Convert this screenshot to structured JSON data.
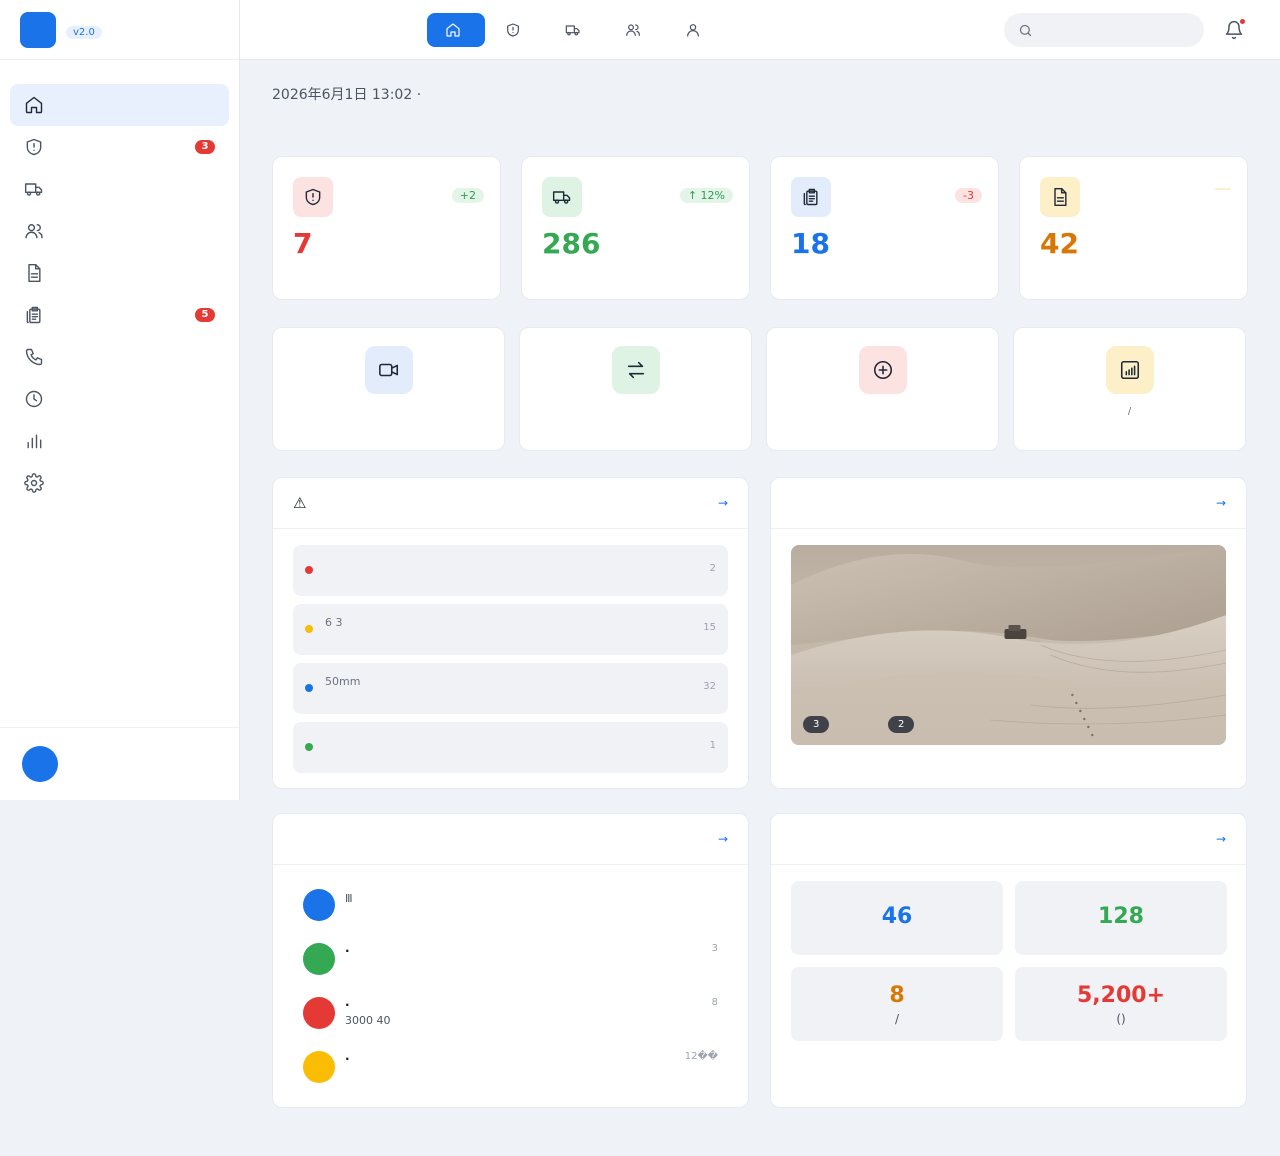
{
  "brand": {
    "logo_glyph": "",
    "name": "",
    "version": "v2.0"
  },
  "sidebar": {
    "section_title": "",
    "items": [
      {
        "label": "",
        "icon": "home-icon",
        "active": true,
        "badge": ""
      },
      {
        "label": "",
        "icon": "shield-alert-icon",
        "active": false,
        "badge": "3"
      },
      {
        "label": "",
        "icon": "truck-icon",
        "active": false,
        "badge": ""
      },
      {
        "label": "",
        "icon": "users-icon",
        "active": false,
        "badge": ""
      },
      {
        "label": "",
        "icon": "document-icon",
        "active": false,
        "badge": ""
      },
      {
        "label": "",
        "icon": "clipboard-icon",
        "active": false,
        "badge": "5"
      },
      {
        "label": "",
        "icon": "phone-icon",
        "active": false,
        "badge": ""
      },
      {
        "label": "",
        "icon": "clock-icon",
        "active": false,
        "badge": ""
      },
      {
        "label": "",
        "icon": "bar-chart-icon",
        "active": false,
        "badge": ""
      },
      {
        "label": "",
        "icon": "gear-icon",
        "active": false,
        "badge": ""
      }
    ],
    "user": {
      "avatar": "",
      "name": "",
      "role": ""
    }
  },
  "topbar": {
    "title": "",
    "tabs": [
      {
        "label": "",
        "icon": "home-icon",
        "active": true
      },
      {
        "label": "",
        "icon": "shield-alert-icon",
        "active": false
      },
      {
        "label": "",
        "icon": "truck-icon",
        "active": false
      },
      {
        "label": "",
        "icon": "users-icon",
        "active": false
      },
      {
        "label": "",
        "icon": "user-icon",
        "active": false
      }
    ],
    "search_placeholder": "",
    "bell_icon": "bell-icon"
  },
  "page": {
    "title": "",
    "subtitle": "2026年6月1日 13:02 · "
  },
  "stats": [
    {
      "value": "7",
      "label": "",
      "chip": "+2",
      "icon": "shield-alert-icon",
      "color": "#e53935",
      "bg": "#fde2e2",
      "chip_color": "#2e9d4f",
      "chip_bg": "#e3f5e8"
    },
    {
      "value": "286",
      "label": "",
      "chip": "↑ 12%",
      "icon": "truck-icon",
      "color": "#34a853",
      "bg": "#dff3e4",
      "chip_color": "#2e9d4f",
      "chip_bg": "#e3f5e8"
    },
    {
      "value": "18",
      "label": "",
      "chip": "-3",
      "icon": "clipboard-icon",
      "color": "#1a73e8",
      "bg": "#e3ecfb",
      "chip_color": "#e53935",
      "chip_bg": "#fde2e2"
    },
    {
      "value": "42",
      "label": "",
      "chip": "",
      "icon": "document-icon",
      "color": "#d97706",
      "bg": "#fdf0c8",
      "chip_color": "#d97706",
      "chip_bg": "#fdf0c8"
    }
  ],
  "actions": [
    {
      "title": "",
      "sub": "",
      "icon": "video-icon",
      "bg": "#e3ecfb"
    },
    {
      "title": "",
      "sub": "",
      "icon": "swap-icon",
      "bg": "#dff3e4"
    },
    {
      "title": "",
      "sub": "",
      "icon": "plus-circle-icon",
      "bg": "#fde2e2"
    },
    {
      "title": "",
      "sub": "/",
      "icon": "report-icon",
      "bg": "#fdf0c8"
    }
  ],
  "alerts_panel": {
    "title": "⚠ ",
    "link": " →",
    "items": [
      {
        "title": "",
        "desc": "",
        "time": "2",
        "color": "#e53935"
      },
      {
        "title": "",
        "desc": "6  3",
        "time": "15",
        "color": "#fbbc04"
      },
      {
        "title": "",
        "desc": "50mm",
        "time": "32",
        "color": "#1a73e8"
      },
      {
        "title": "",
        "desc": "",
        "time": "1",
        "color": "#34a853"
      }
    ]
  },
  "photo_panel": {
    "title": " ",
    "link": " →",
    "tags": [
      " 3",
      " 2"
    ]
  },
  "messages_panel": {
    "title": " ",
    "link": " →",
    "items": [
      {
        "avatar": "",
        "name": "",
        "text": "Ⅲ",
        "time": "",
        "color": "#1a73e8"
      },
      {
        "avatar": "",
        "name": " · ",
        "text": "",
        "time": "3",
        "color": "#34a853"
      },
      {
        "avatar": "",
        "name": " · ",
        "text": "3000  40",
        "time": "8",
        "color": "#e53935"
      },
      {
        "avatar": "",
        "name": " · ",
        "text": "",
        "time": "12��",
        "color": "#fbbc04"
      }
    ]
  },
  "summary_panel": {
    "title": " ",
    "link": " →",
    "cells": [
      {
        "value": "46",
        "label": "",
        "color": "#1a73e8"
      },
      {
        "value": "128",
        "label": "",
        "color": "#34a853"
      },
      {
        "value": "8",
        "label": "/",
        "color": "#d97706"
      },
      {
        "value": "5,200+",
        "label": "()",
        "color": "#e53935"
      }
    ]
  }
}
